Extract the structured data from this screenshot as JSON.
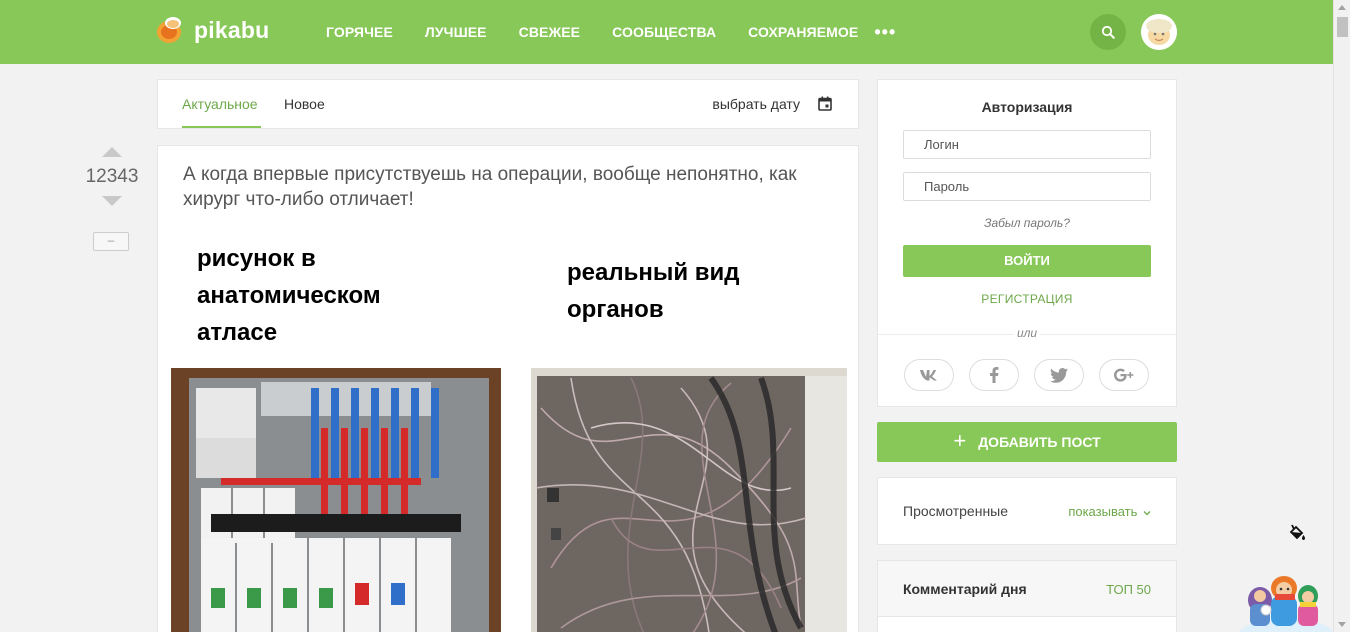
{
  "header": {
    "logo_text": "pikabu",
    "nav": [
      "ГОРЯЧЕЕ",
      "ЛУЧШЕЕ",
      "СВЕЖЕЕ",
      "СООБЩЕСТВА",
      "СОХРАНЯЕМОЕ"
    ],
    "more": "•••",
    "icons": {
      "search": "search-icon",
      "more": "more-dots-icon"
    }
  },
  "feed": {
    "tabs": [
      "Актуальное",
      "Новое"
    ],
    "active_tab": "Актуальное",
    "date_picker": "выбрать дату"
  },
  "story": {
    "rating": "12343",
    "collapse": "–",
    "title": "А когда впервые присутствуешь на операции, вообще непонятно, как хирург что-либо отличает!",
    "caption_left": [
      "рисунок в",
      "анатомическом",
      "атласе"
    ],
    "caption_right": [
      "реальный вид",
      "органов"
    ]
  },
  "auth": {
    "title": "Авторизация",
    "login_placeholder": "Логин",
    "password_placeholder": "Пароль",
    "forgot": "Забыл пароль?",
    "login_button": "ВОЙТИ",
    "register": "РЕГИСТРАЦИЯ",
    "or": "или",
    "social": [
      "vk-icon",
      "facebook-icon",
      "twitter-icon",
      "google-plus-icon"
    ]
  },
  "sidebar": {
    "add_post": "ДОБАВИТЬ ПОСТ",
    "viewed_label": "Просмотренные",
    "viewed_toggle": "показывать",
    "comment_title": "Комментарий дня",
    "comment_top": "ТОП 50"
  },
  "colors": {
    "brand_green": "#88c858",
    "link_green": "#6da84a",
    "logo_orange": "#f08a24"
  }
}
